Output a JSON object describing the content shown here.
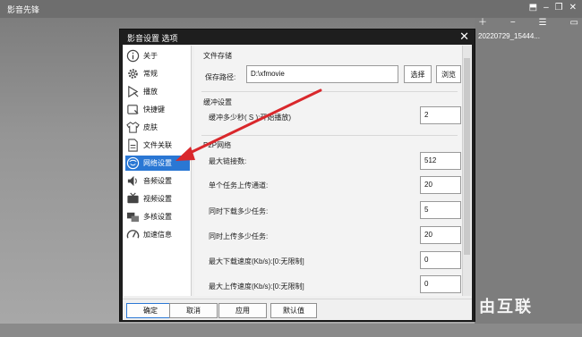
{
  "app": {
    "title": "影音先锋",
    "playlist_item": "20220729_15444...",
    "watermark": "自由互联"
  },
  "dialog": {
    "title": "影音设置 选项",
    "close": "✕",
    "nav": [
      {
        "label": "关于",
        "icon": "info-icon"
      },
      {
        "label": "常规",
        "icon": "gear-icon"
      },
      {
        "label": "播放",
        "icon": "play-icon"
      },
      {
        "label": "快捷键",
        "icon": "keyboard-icon"
      },
      {
        "label": "皮肤",
        "icon": "shirt-icon"
      },
      {
        "label": "文件关联",
        "icon": "file-link-icon"
      },
      {
        "label": "网络设置",
        "icon": "network-icon",
        "selected": true
      },
      {
        "label": "音频设置",
        "icon": "audio-icon"
      },
      {
        "label": "视频设置",
        "icon": "tv-icon"
      },
      {
        "label": "多核设置",
        "icon": "multicore-icon"
      },
      {
        "label": "加速信息",
        "icon": "speedometer-icon"
      }
    ],
    "file_storage": {
      "section": "文件存储",
      "label": "保存路径:",
      "value": "D:\\xfmovie",
      "select_btn": "选择",
      "browse_btn": "浏览"
    },
    "buffer": {
      "section": "缓冲设置",
      "label": "缓冲多少秒( S ):开始播放)",
      "value": "2"
    },
    "p2p": {
      "section": "P2P网络",
      "rows": [
        {
          "label": "最大链接数:",
          "value": "512"
        },
        {
          "label": "单个任务上传通道:",
          "value": "20"
        },
        {
          "label": "同时下载多少任务:",
          "value": "5"
        },
        {
          "label": "同时上传多少任务:",
          "value": "20"
        },
        {
          "label": "最大下载速度(Kb/s):[0:无限制]",
          "value": "0"
        },
        {
          "label": "最大上传速度(Kb/s):[0:无限制]",
          "value": "0"
        }
      ]
    },
    "footer": {
      "ok": "确定",
      "cancel": "取消",
      "apply": "应用",
      "default": "默认值"
    }
  },
  "colors": {
    "accent": "#2a77d4",
    "arrow": "#d9282c"
  }
}
